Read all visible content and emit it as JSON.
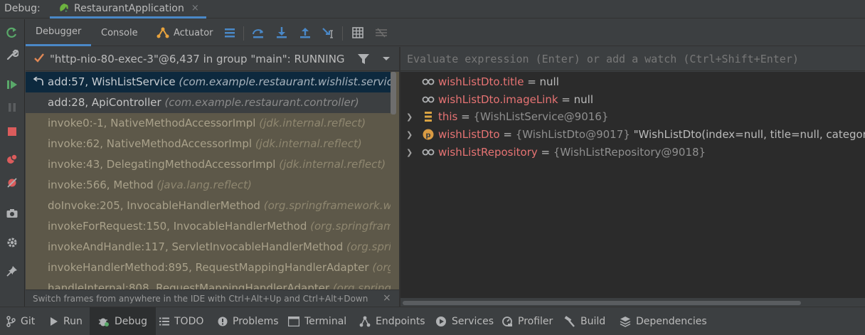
{
  "titlebar": {
    "debug_label": "Debug:",
    "run_config": "RestaurantApplication",
    "close_glyph": "×"
  },
  "toolbar": {
    "tabs": [
      {
        "label": "Debugger",
        "active": true
      },
      {
        "label": "Console",
        "active": false
      },
      {
        "label": "Actuator",
        "active": false,
        "icon": "actuator-icon"
      }
    ],
    "buttons": [
      "layout-menu-icon",
      "show-execution-point-icon",
      "step-over-icon",
      "step-into-icon",
      "step-out-icon",
      "run-to-cursor-icon",
      "evaluate-expression-icon",
      "trace-current-stream-icon"
    ]
  },
  "gutter": {
    "buttons": [
      "rerun-icon",
      "settings-wrench-icon",
      "resume-icon",
      "pause-icon",
      "stop-icon",
      "view-breakpoints-icon",
      "mute-breakpoints-icon",
      "camera-icon",
      "settings-gear-icon",
      "pin-icon"
    ]
  },
  "thread": {
    "label": "\"http-nio-80-exec-3\"@6,437 in group \"main\": RUNNING"
  },
  "frames": [
    {
      "method": "add:57, WishListService",
      "pkg": "(com.example.restaurant.wishlist.service)",
      "kind": "selected"
    },
    {
      "method": "add:28, ApiController",
      "pkg": "(com.example.restaurant.controller)",
      "kind": "user"
    },
    {
      "method": "invoke0:-1, NativeMethodAccessorImpl",
      "pkg": "(jdk.internal.reflect)",
      "kind": "lib"
    },
    {
      "method": "invoke:62, NativeMethodAccessorImpl",
      "pkg": "(jdk.internal.reflect)",
      "kind": "lib"
    },
    {
      "method": "invoke:43, DelegatingMethodAccessorImpl",
      "pkg": "(jdk.internal.reflect)",
      "kind": "lib"
    },
    {
      "method": "invoke:566, Method",
      "pkg": "(java.lang.reflect)",
      "kind": "lib"
    },
    {
      "method": "doInvoke:205, InvocableHandlerMethod",
      "pkg": "(org.springframework.web",
      "kind": "lib"
    },
    {
      "method": "invokeForRequest:150, InvocableHandlerMethod",
      "pkg": "(org.springframew",
      "kind": "lib"
    },
    {
      "method": "invokeAndHandle:117, ServletInvocableHandlerMethod",
      "pkg": "(org.spring",
      "kind": "lib"
    },
    {
      "method": "invokeHandlerMethod:895, RequestMappingHandlerAdapter",
      "pkg": "(org.",
      "kind": "lib"
    },
    {
      "method": "handleInternal:808, RequestMappingHandlerAdapter",
      "pkg": "(org.springfra",
      "kind": "lib"
    }
  ],
  "hint": {
    "text": "Switch frames from anywhere in the IDE with Ctrl+Alt+Up and Ctrl+Alt+Down",
    "close_glyph": "×"
  },
  "evaluate": {
    "placeholder": "Evaluate expression (Enter) or add a watch (Ctrl+Shift+Enter)"
  },
  "variables": [
    {
      "icon": "watch-icon",
      "expandable": false,
      "name": "wishListDto.title",
      "op": " = ",
      "value": "null",
      "type": ""
    },
    {
      "icon": "watch-icon",
      "expandable": false,
      "name": "wishListDto.imageLink",
      "op": " = ",
      "value": "null",
      "type": ""
    },
    {
      "icon": "field-stack-icon",
      "expandable": true,
      "name": "this",
      "op": " = ",
      "value": "",
      "type": "{WishListService@9016}"
    },
    {
      "icon": "parameter-icon",
      "expandable": true,
      "name": "wishListDto",
      "op": " = ",
      "value": "\"WishListDto(index=null, title=null, category=nul",
      "type": "{WishListDto@9017} "
    },
    {
      "icon": "watch-icon",
      "expandable": true,
      "name": "wishListRepository",
      "op": " = ",
      "value": "",
      "type": "{WishListRepository@9018}"
    }
  ],
  "bottom_tabs": [
    {
      "label": "Git",
      "icon": "git-branch-icon",
      "active": false
    },
    {
      "label": "Run",
      "icon": "run-icon",
      "active": false
    },
    {
      "label": "Debug",
      "icon": "debug-bug-icon",
      "active": true
    },
    {
      "label": "TODO",
      "icon": "todo-list-icon",
      "active": false
    },
    {
      "label": "Problems",
      "icon": "problems-icon",
      "active": false
    },
    {
      "label": "Terminal",
      "icon": "terminal-icon",
      "active": false
    },
    {
      "label": "Endpoints",
      "icon": "endpoints-icon",
      "active": false
    },
    {
      "label": "Services",
      "icon": "services-icon",
      "active": false
    },
    {
      "label": "Profiler",
      "icon": "profiler-icon",
      "active": false
    },
    {
      "label": "Build",
      "icon": "build-hammer-icon",
      "active": false
    },
    {
      "label": "Dependencies",
      "icon": "dependencies-icon",
      "active": false
    }
  ],
  "colors": {
    "background": "#3c3f41",
    "accent": "#4a88c7",
    "selected_frame": "#0d293e",
    "library_frame": "#5d5849",
    "variable_name": "#e67373",
    "variables_bg": "#2b2b2b"
  }
}
